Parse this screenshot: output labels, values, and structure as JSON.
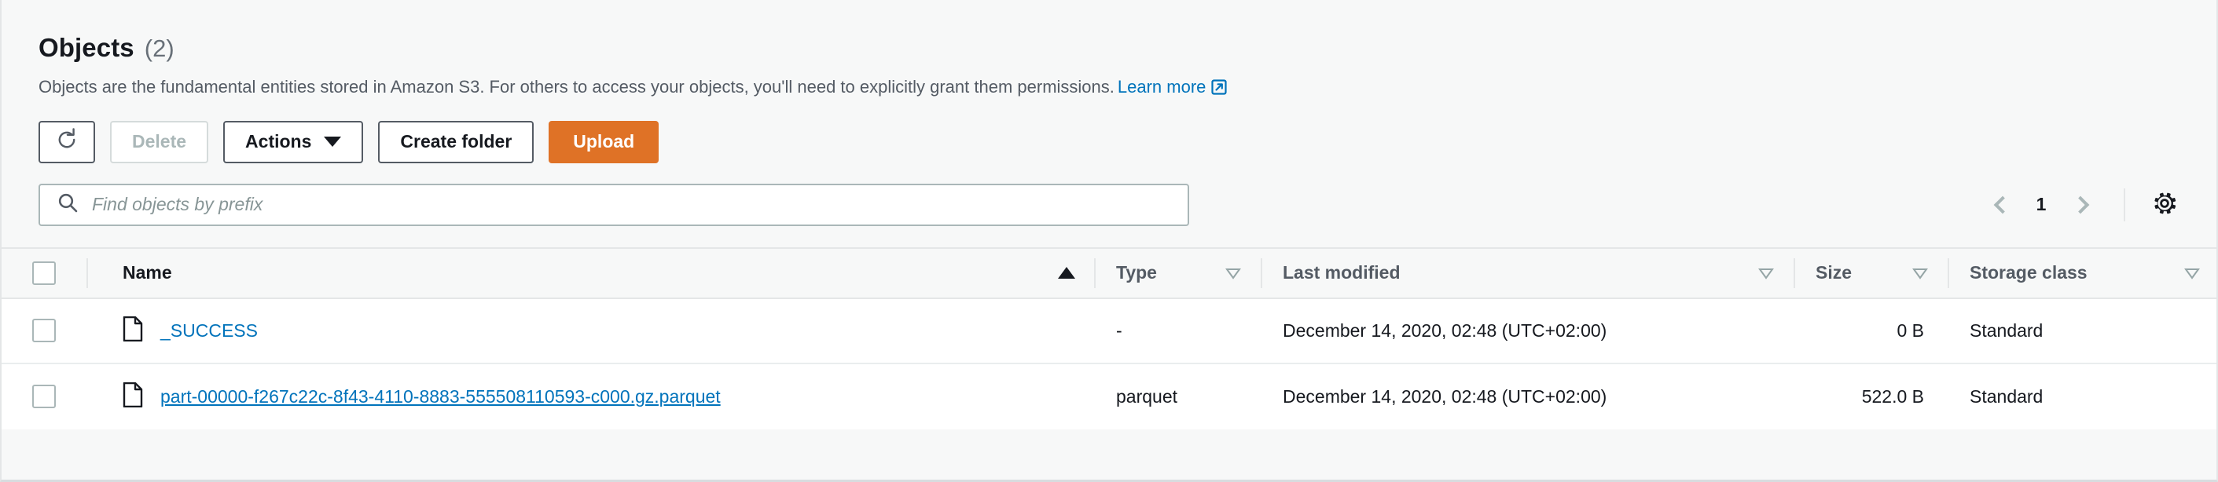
{
  "header": {
    "title": "Objects",
    "count": "(2)",
    "description": "Objects are the fundamental entities stored in Amazon S3. For others to access your objects, you'll need to explicitly grant them permissions.",
    "learn_more": "Learn more"
  },
  "toolbar": {
    "refresh_label": "",
    "delete_label": "Delete",
    "actions_label": "Actions",
    "create_folder_label": "Create folder",
    "upload_label": "Upload"
  },
  "search": {
    "value": "",
    "placeholder": "Find objects by prefix"
  },
  "pagination": {
    "page": "1"
  },
  "table": {
    "columns": [
      {
        "label": "Name",
        "sort": "asc"
      },
      {
        "label": "Type",
        "sort": "none"
      },
      {
        "label": "Last modified",
        "sort": "none"
      },
      {
        "label": "Size",
        "sort": "none"
      },
      {
        "label": "Storage class",
        "sort": "none"
      }
    ],
    "rows": [
      {
        "name": "_SUCCESS",
        "type": "-",
        "last_modified": "December 14, 2020, 02:48 (UTC+02:00)",
        "size": "0 B",
        "storage_class": "Standard"
      },
      {
        "name": "part-00000-f267c22c-8f43-4110-8883-555508110593-c000.gz.parquet",
        "type": "parquet",
        "last_modified": "December 14, 2020, 02:48 (UTC+02:00)",
        "size": "522.0 B",
        "storage_class": "Standard"
      }
    ]
  },
  "colors": {
    "primary_button": "#df7226",
    "link": "#0073bb",
    "text": "#16191f",
    "muted_text": "#545b64",
    "border": "#e4e6e7"
  }
}
